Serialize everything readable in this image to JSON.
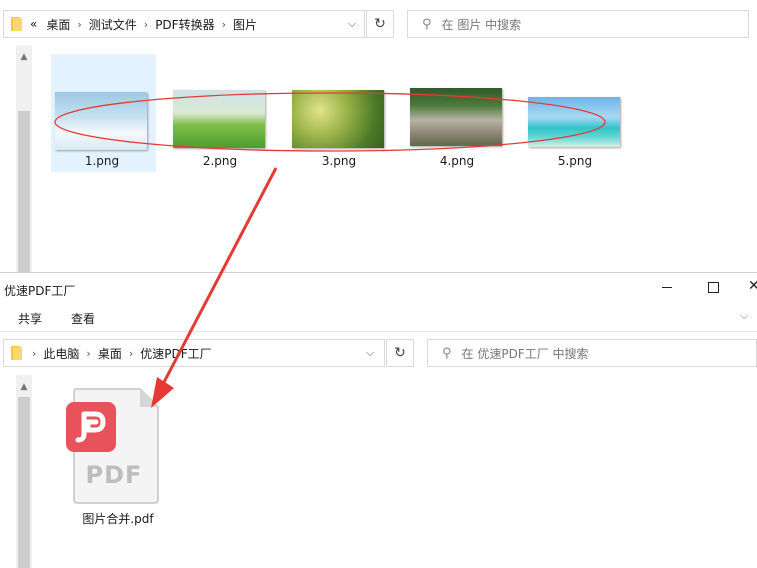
{
  "top_window": {
    "breadcrumb": [
      "«",
      "桌面",
      "测试文件",
      "PDF转换器",
      "图片"
    ],
    "search_placeholder": "在 图片 中搜索",
    "files": [
      {
        "name": "1.png",
        "selected": true
      },
      {
        "name": "2.png"
      },
      {
        "name": "3.png"
      },
      {
        "name": "4.png"
      },
      {
        "name": "5.png"
      }
    ]
  },
  "bottom_window": {
    "title": "优速PDF工厂",
    "ribbon_tabs": [
      "共享",
      "查看"
    ],
    "breadcrumb": [
      "此电脑",
      "桌面",
      "优速PDF工厂"
    ],
    "search_placeholder": "在 优速PDF工厂 中搜索",
    "file": {
      "name": "图片合并.pdf",
      "icon_text": "PDF"
    }
  },
  "colors": {
    "selection": "#cce8ff",
    "annotation_red": "#e53935",
    "pdf_badge": "#e8525a"
  }
}
